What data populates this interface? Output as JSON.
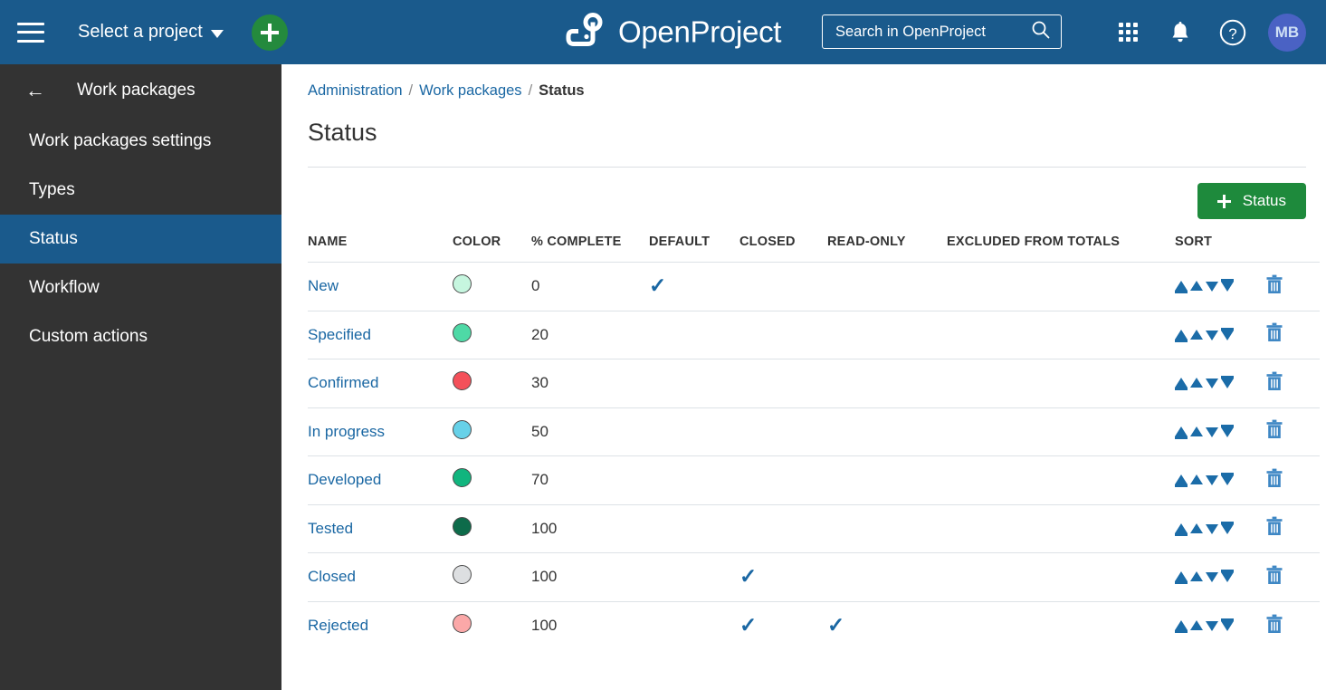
{
  "colors": {
    "header_blue": "#1A5A8C",
    "sidebar_dark": "#333333",
    "accent_link": "#1A67A3",
    "green_button": "#1E8A3C",
    "add_circle_green": "#248A3D",
    "avatar_purple": "#4A62C4"
  },
  "header": {
    "menu_icon": "hamburger-icon",
    "project_selector_label": "Select a project",
    "add_button_label": "+",
    "brand_name": "OpenProject",
    "brand_logo_icon": "openproject-logo-icon",
    "search": {
      "placeholder": "Search in OpenProject",
      "value": "",
      "icon": "search-icon"
    },
    "icons": [
      {
        "name": "modules-grid-icon"
      },
      {
        "name": "notification-bell-icon"
      },
      {
        "name": "help-question-icon"
      }
    ],
    "avatar_initials": "MB"
  },
  "sidebar": {
    "back_arrow": "←",
    "title": "Work packages",
    "items": [
      {
        "label": "Work packages settings",
        "active": false
      },
      {
        "label": "Types",
        "active": false
      },
      {
        "label": "Status",
        "active": true
      },
      {
        "label": "Workflow",
        "active": false
      },
      {
        "label": "Custom actions",
        "active": false
      }
    ]
  },
  "breadcrumb": {
    "items": [
      {
        "label": "Administration",
        "link": true
      },
      {
        "label": "Work packages",
        "link": true
      },
      {
        "label": "Status",
        "link": false
      }
    ],
    "separator": "/"
  },
  "page": {
    "title": "Status"
  },
  "toolbar": {
    "add_status_label": "Status",
    "add_status_icon": "plus-icon"
  },
  "table": {
    "columns": [
      "NAME",
      "COLOR",
      "% COMPLETE",
      "DEFAULT",
      "CLOSED",
      "READ-ONLY",
      "EXCLUDED FROM TOTALS",
      "SORT"
    ],
    "sort_icons": [
      {
        "name": "move-to-top-icon"
      },
      {
        "name": "move-up-icon"
      },
      {
        "name": "move-down-icon"
      },
      {
        "name": "move-to-bottom-icon"
      }
    ],
    "delete_icon": "trash-icon",
    "check_glyph": "✓",
    "rows": [
      {
        "name": "New",
        "color": "#C6F6DF",
        "percent_complete": "0",
        "default": true,
        "closed": false,
        "read_only": false,
        "excluded_from_totals": false
      },
      {
        "name": "Specified",
        "color": "#4ED9A6",
        "percent_complete": "20",
        "default": false,
        "closed": false,
        "read_only": false,
        "excluded_from_totals": false
      },
      {
        "name": "Confirmed",
        "color": "#F4505A",
        "percent_complete": "30",
        "default": false,
        "closed": false,
        "read_only": false,
        "excluded_from_totals": false
      },
      {
        "name": "In progress",
        "color": "#67D1E8",
        "percent_complete": "50",
        "default": false,
        "closed": false,
        "read_only": false,
        "excluded_from_totals": false
      },
      {
        "name": "Developed",
        "color": "#11B57E",
        "percent_complete": "70",
        "default": false,
        "closed": false,
        "read_only": false,
        "excluded_from_totals": false
      },
      {
        "name": "Tested",
        "color": "#0D6B4A",
        "percent_complete": "100",
        "default": false,
        "closed": false,
        "read_only": false,
        "excluded_from_totals": false
      },
      {
        "name": "Closed",
        "color": "#DDDFE1",
        "percent_complete": "100",
        "default": false,
        "closed": true,
        "read_only": false,
        "excluded_from_totals": false
      },
      {
        "name": "Rejected",
        "color": "#FBA8A8",
        "percent_complete": "100",
        "default": false,
        "closed": true,
        "read_only": true,
        "excluded_from_totals": false
      }
    ]
  }
}
